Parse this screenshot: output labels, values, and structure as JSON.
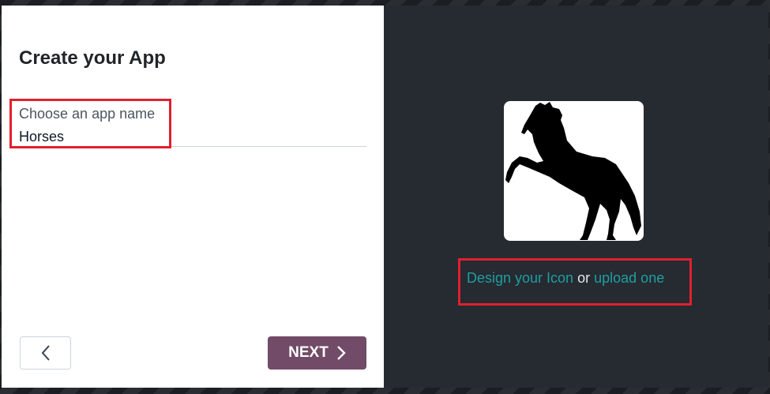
{
  "dialog": {
    "title": "Create your App",
    "app_name_field": {
      "label": "Choose an app name",
      "value": "Horses"
    },
    "buttons": {
      "back_icon": "chevron-left-icon",
      "next_label": "NEXT",
      "next_icon": "chevron-right-icon"
    },
    "icon_panel": {
      "icon_image": "horse-silhouette-icon",
      "design_link": "Design your Icon",
      "separator": "or",
      "upload_link": "upload one"
    }
  },
  "colors": {
    "accent": "#714b67",
    "link": "#1f9fa0",
    "highlight": "#e0202e",
    "panel_dark": "#262a31"
  }
}
